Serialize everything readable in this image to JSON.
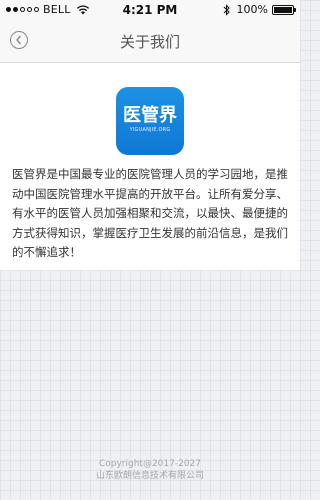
{
  "status_bar": {
    "carrier": "BELL",
    "time": "4:21 PM",
    "battery": "100%"
  },
  "nav": {
    "title": "关于我们"
  },
  "logo": {
    "text": "医管界",
    "subtext": "YIGUANJIE.ORG"
  },
  "content": {
    "description": "医管界是中国最专业的医院管理人员的学习园地，是推动中国医院管理水平提高的开放平台。让所有爱分享、有水平的医管人员加强相聚和交流，以最快、最便捷的方式获得知识，掌握医疗卫生发展的前沿信息，是我们的不懈追求！"
  },
  "footer": {
    "copyright": "Copyright@2017-2027",
    "company": "山东欧朗信息技术有限公司"
  },
  "colors": {
    "accent": "#1a8ae0",
    "background": "#eef0f4"
  }
}
